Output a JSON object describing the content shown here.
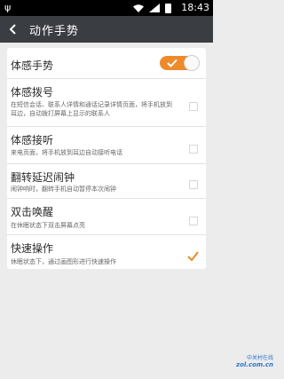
{
  "status_bar": {
    "time": "18:43",
    "usb_glyph": "ψ",
    "icons": [
      "usb-icon",
      "wifi-icon",
      "signal-icon",
      "battery-icon"
    ]
  },
  "header": {
    "title": "动作手势",
    "back_icon": "back-arrow-icon"
  },
  "colors": {
    "accent": "#ee8a2a",
    "header_bg": "#3a3d42",
    "page_bg": "#ececec"
  },
  "settings": {
    "master": {
      "label": "体感手势",
      "enabled": true
    },
    "items": [
      {
        "title": "体感拨号",
        "desc": "在短信会话、联系人详情和通话记录详情页面，将手机放到耳边，自动拨打屏幕上显示的联系人",
        "checked": false
      },
      {
        "title": "体感接听",
        "desc": "来电页面，将手机放到耳边自动接听电话",
        "checked": false
      },
      {
        "title": "翻转延迟闹钟",
        "desc": "闹钟响时，翻转手机自动暂停本次闹钟",
        "checked": false
      },
      {
        "title": "双击唤醒",
        "desc": "在休眠状态下双击屏幕点亮",
        "checked": false
      },
      {
        "title": "快速操作",
        "desc": "休眠状态下，通过画图形进行快速操作",
        "checked": true
      }
    ]
  },
  "watermark": {
    "line1": "中关村在线",
    "line2": "zol.com.cn"
  }
}
